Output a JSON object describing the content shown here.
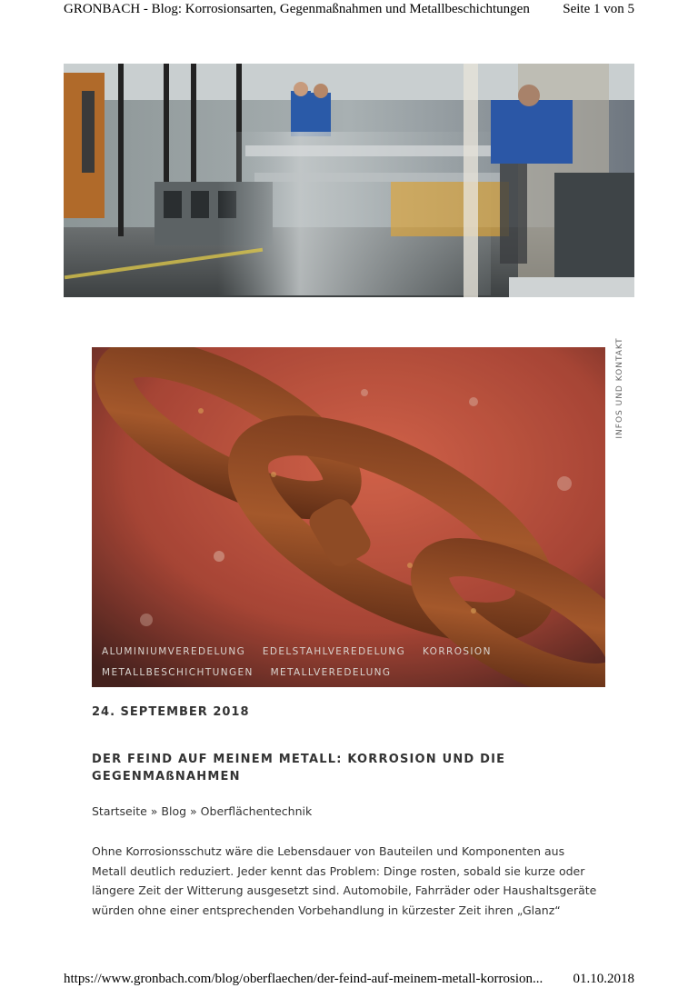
{
  "print_header": {
    "title": "GRONBACH - Blog: Korrosionsarten, Gegenmaßnahmen und Metallbeschichtungen",
    "page": "Seite 1 von 5"
  },
  "hero": {
    "alt_icon": "factory-photo"
  },
  "side_tab": {
    "label": "INFOS UND KONTAKT"
  },
  "post": {
    "image_icon": "rusty-chain-photo",
    "tags": [
      "ALUMINIUMVEREDELUNG",
      "EDELSTAHLVEREDELUNG",
      "KORROSION",
      "METALLBESCHICHTUNGEN",
      "METALLVEREDELUNG"
    ],
    "date": "24. SEPTEMBER 2018",
    "title_line1": "DER FEIND AUF MEINEM METALL: KORROSION UND DIE",
    "title_line2": "GEGENMAßNAHMEN",
    "breadcrumb": {
      "home": "Startseite",
      "sep": " » ",
      "blog": "Blog",
      "category": "Oberflächentechnik"
    },
    "body_lines": [
      "Ohne Korrosionsschutz wäre die Lebensdauer von Bauteilen und Komponenten aus",
      "Metall deutlich reduziert. Jeder kennt das Problem: Dinge rosten, sobald sie kurze oder",
      "längere Zeit der Witterung ausgesetzt sind. Automobile, Fahrräder oder Haushaltsgeräte",
      "würden ohne einer entsprechenden Vorbehandlung in kürzester Zeit ihren „Glanz“"
    ]
  },
  "print_footer": {
    "url": "https://www.gronbach.com/blog/oberflaechen/der-feind-auf-meinem-metall-korrosion...",
    "date": "01.10.2018"
  }
}
